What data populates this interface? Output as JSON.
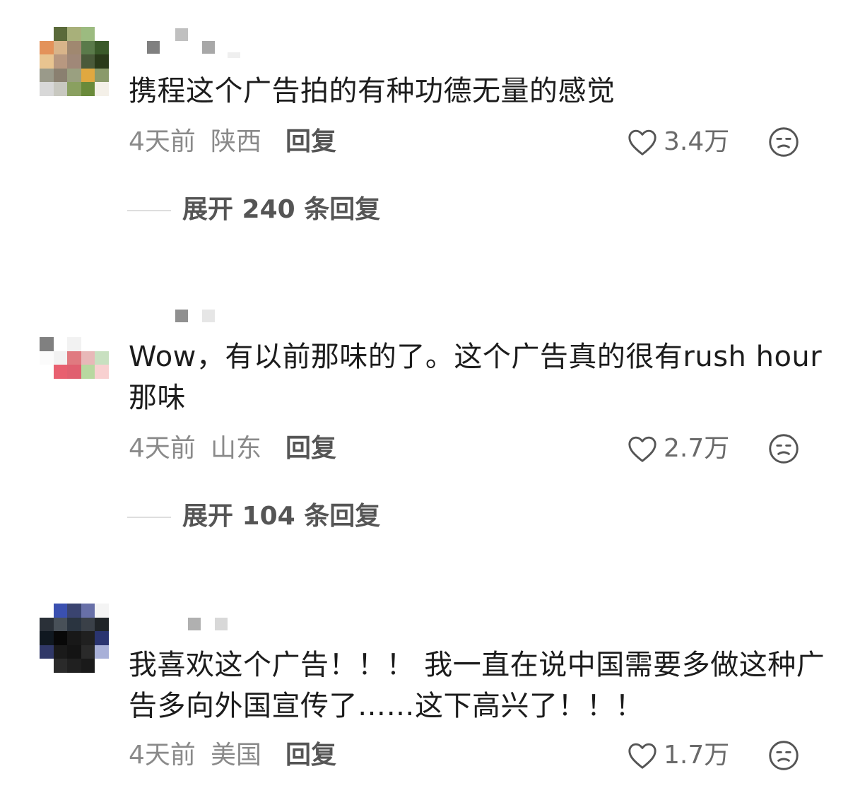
{
  "comments": [
    {
      "text": "携程这个广告拍的有种功德无量的感觉",
      "time": "4天前",
      "location": "陕西",
      "reply_label": "回复",
      "likes": "3.4万",
      "expand_label": "展开 240 条回复"
    },
    {
      "text": "Wow，有以前那味的了。这个广告真的很有rush hour那味",
      "time": "4天前",
      "location": "山东",
      "reply_label": "回复",
      "likes": "2.7万",
      "expand_label": "展开 104 条回复"
    },
    {
      "text": "我喜欢这个广告！！！ 我一直在说中国需要多做这种广告多向外国宣传了……这下高兴了！！！",
      "time": "4天前",
      "location": "美国",
      "reply_label": "回复",
      "likes": "1.7万"
    }
  ],
  "colors": {
    "text": "#1c1c1c",
    "meta": "#8a8a8a",
    "reply": "#555555",
    "divider": "#dedede"
  },
  "icons": {
    "like": "heart-outline-icon",
    "dislike": "meh-face-icon"
  }
}
